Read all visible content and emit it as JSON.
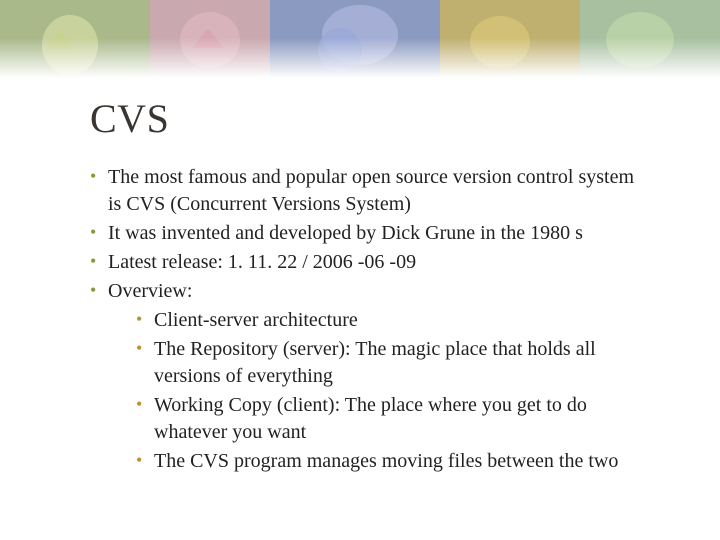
{
  "title": "CVS",
  "bullets": {
    "b1": "The most famous and popular open source version control system is CVS (Concurrent Versions System)",
    "b2": "It was invented and developed by Dick Grune in the 1980 s",
    "b3": "Latest release: 1. 11. 22 / 2006 -06 -09",
    "b4": "Overview:",
    "sub": {
      "s1": "Client-server architecture",
      "s2": "The Repository (server): The magic place that holds all versions of everything",
      "s3": "Working Copy (client): The place where you get to do whatever you want",
      "s4": "The CVS program manages moving files between the two"
    }
  }
}
